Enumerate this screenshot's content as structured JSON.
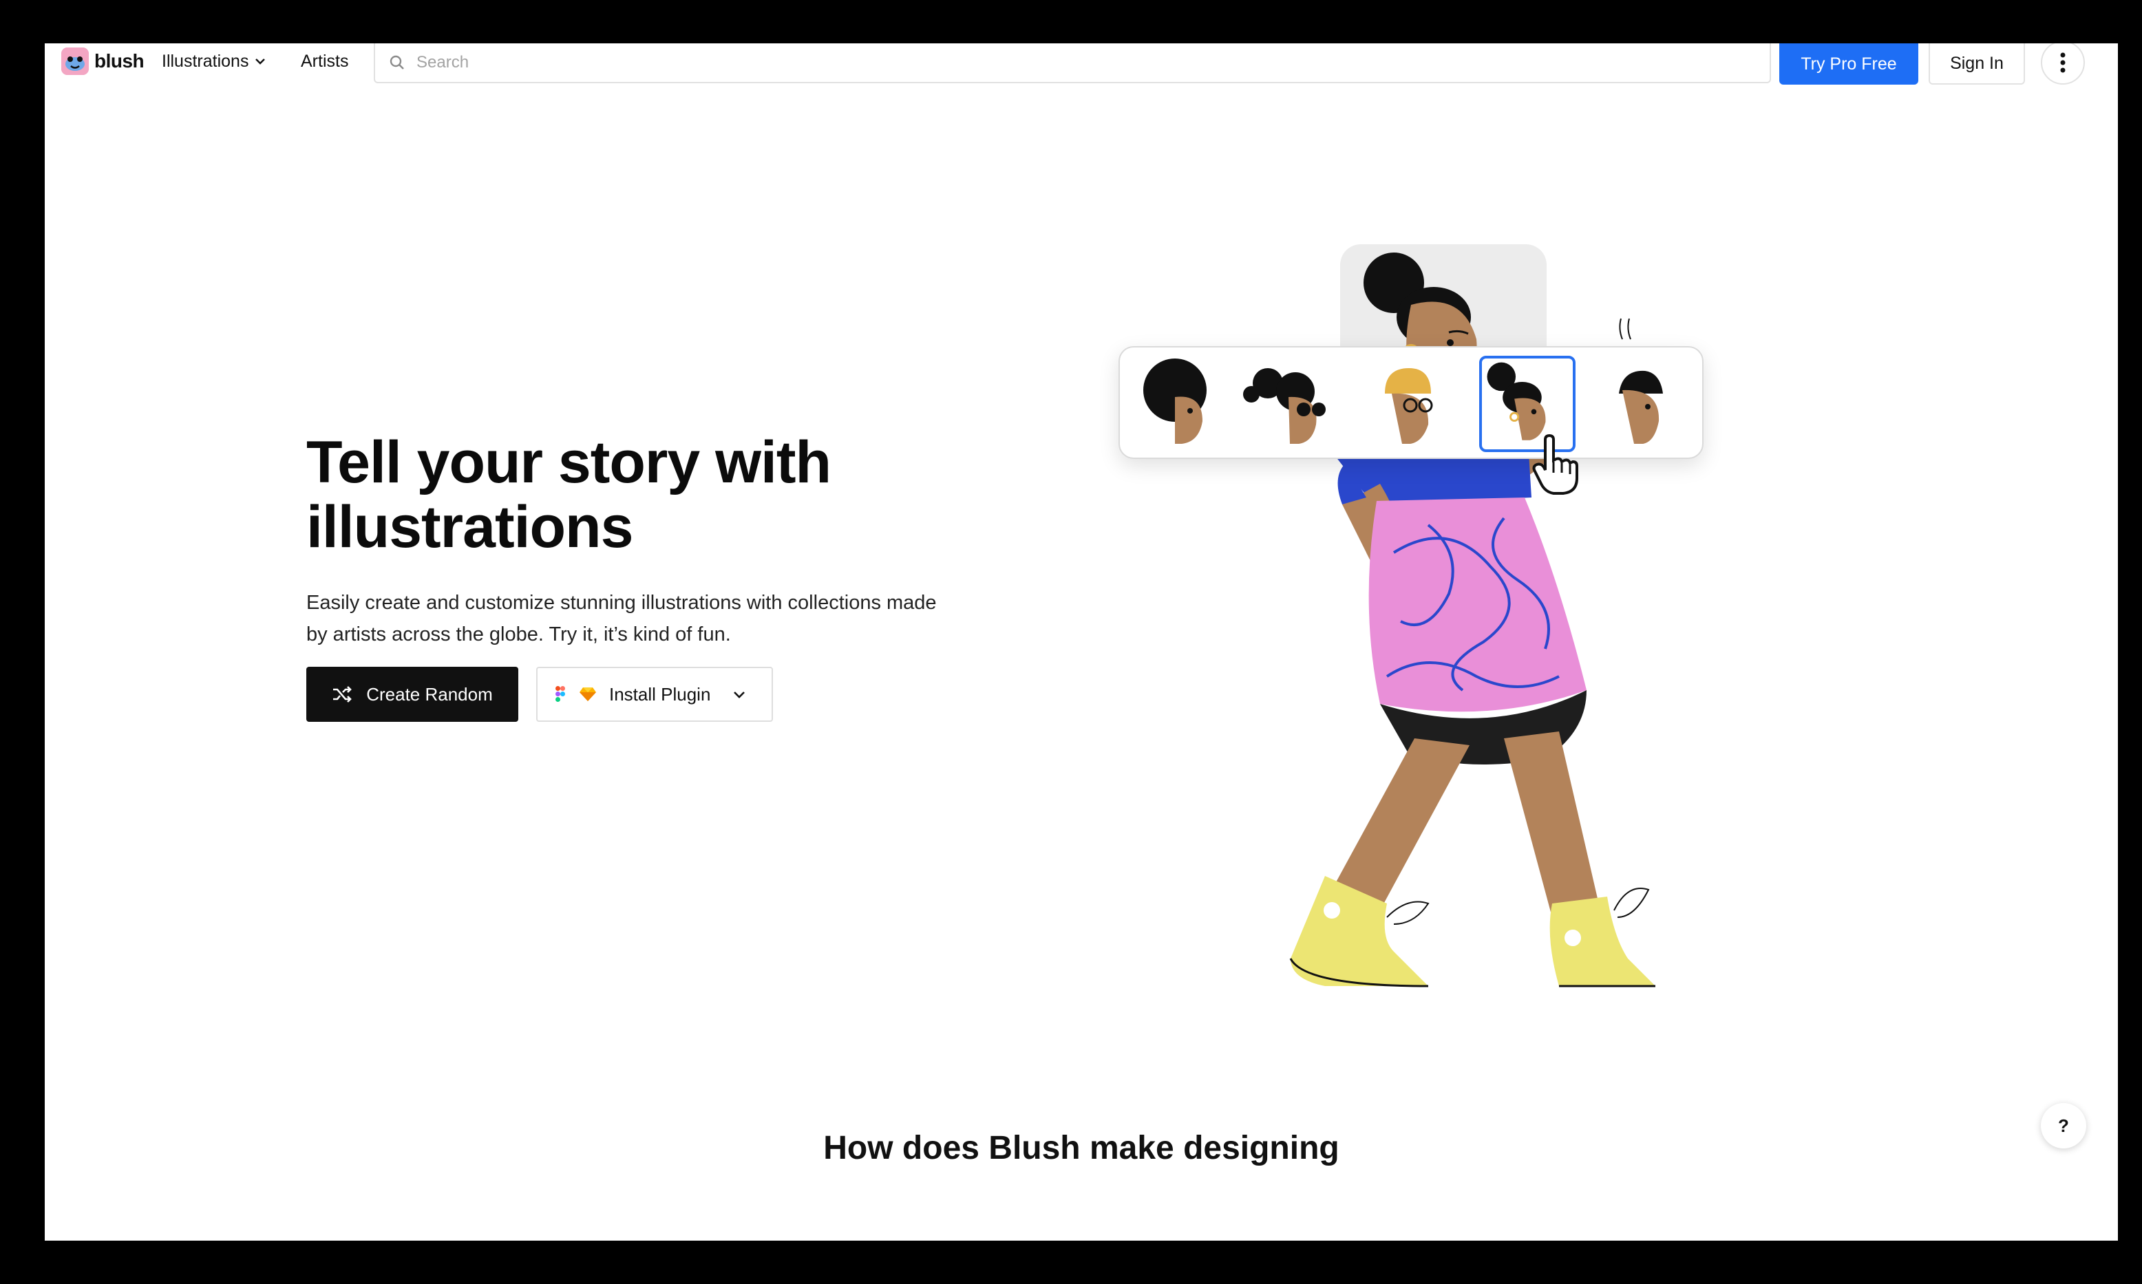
{
  "nav": {
    "brand": "blush",
    "illustrations_label": "Illustrations",
    "artists_label": "Artists",
    "search_placeholder": "Search",
    "try_pro_label": "Try Pro Free",
    "sign_in_label": "Sign In"
  },
  "hero": {
    "title": "Tell your story with illustrations",
    "description": "Easily create and customize stunning illustrations with collections made by artists across the globe. Try it, it’s kind of fun.",
    "create_random_label": "Create Random",
    "install_plugin_label": "Install Plugin"
  },
  "picker": {
    "options": [
      "afro-hair-face",
      "buns-sunglasses-face",
      "beanie-glasses-face",
      "bun-earring-face",
      "short-hair-face"
    ],
    "selected_index": 3
  },
  "section": {
    "title": "How does Blush make designing"
  },
  "help_label": "?",
  "colors": {
    "accent_blue": "#1e6ef5",
    "dress_pink": "#e98fd8",
    "shirt_blue": "#2a47cc",
    "skin": "#b3835a",
    "boot_yellow": "#ece573"
  }
}
